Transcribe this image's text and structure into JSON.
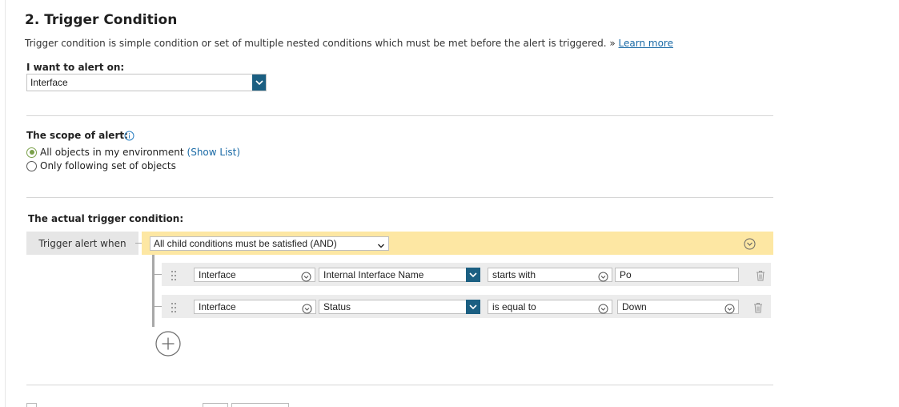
{
  "section": {
    "title": "2. Trigger Condition",
    "description": "Trigger condition is simple condition or set of multiple nested conditions which must be met before the alert is triggered.",
    "description_sep": " » ",
    "learn_more": "Learn more"
  },
  "alert_on": {
    "label": "I want to alert on:",
    "value": "Interface"
  },
  "scope": {
    "label": "The scope of alert:",
    "options": [
      {
        "label": "All objects in my environment",
        "link": "(Show List)",
        "selected": true
      },
      {
        "label": "Only following set of objects",
        "selected": false
      }
    ]
  },
  "trigger": {
    "label": "The actual trigger condition:",
    "when_label": "Trigger alert when",
    "group_condition": "All child conditions must be satisfied (AND)",
    "rows": [
      {
        "object": "Interface",
        "property": "Internal Interface Name",
        "operator": "starts with",
        "value": "Po"
      },
      {
        "object": "Interface",
        "property": "Status",
        "operator": "is equal to",
        "value": "Down"
      }
    ]
  },
  "colors": {
    "accent_blue": "#1b5f82",
    "link_blue": "#1a6aa6",
    "group_bar": "#fde7a3",
    "radio_green": "#7aa049"
  }
}
